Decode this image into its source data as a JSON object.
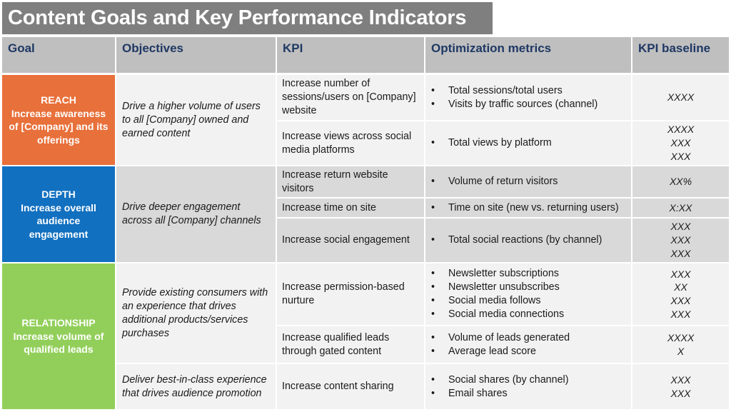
{
  "title": "Content Goals and Key Performance Indicators",
  "headers": {
    "goal": "Goal",
    "objectives": "Objectives",
    "kpi": "KPI",
    "metrics": "Optimization metrics",
    "baseline": "KPI baseline"
  },
  "colors": {
    "title_bg": "#7f7f7f",
    "header_bg": "#bfbfbf",
    "header_text": "#1f3864",
    "reach": "#e8703a",
    "depth": "#1270c0",
    "relationship": "#92cf5a",
    "row_light": "#f2f2f2",
    "row_mid": "#d9d9d9"
  },
  "goals": [
    {
      "name": "REACH",
      "description": "Increase awareness of [Company] and its offerings",
      "objectives": [
        "Drive a higher volume of users to all [Company] owned and earned content"
      ],
      "kpis": [
        {
          "kpi": "Increase number of sessions/users on [Company] website",
          "metrics": [
            "Total sessions/total users",
            "Visits by traffic sources (channel)"
          ],
          "baseline": [
            "XXXX"
          ]
        },
        {
          "kpi": "Increase views across social media platforms",
          "metrics": [
            "Total views by platform"
          ],
          "baseline": [
            "XXXX",
            "XXX",
            "XXX"
          ]
        }
      ]
    },
    {
      "name": "DEPTH",
      "description": "Increase overall audience engagement",
      "objectives": [
        "Drive deeper engagement across all [Company] channels"
      ],
      "kpis": [
        {
          "kpi": "Increase return website visitors",
          "metrics": [
            "Volume of return visitors"
          ],
          "baseline": [
            "XX%"
          ]
        },
        {
          "kpi": "Increase time on site",
          "metrics": [
            "Time on site (new vs. returning users)"
          ],
          "baseline": [
            "X:XX"
          ]
        },
        {
          "kpi": "Increase social engagement",
          "metrics": [
            "Total social reactions (by channel)"
          ],
          "baseline": [
            "XXX",
            "XXX",
            "XXX"
          ]
        }
      ]
    },
    {
      "name": "RELATIONSHIP",
      "description": "Increase volume of qualified leads",
      "objectives": [
        "Provide existing consumers with an experience that drives additional products/services purchases",
        "Deliver best-in-class experience that drives audience promotion"
      ],
      "kpis": [
        {
          "kpi": "Increase permission-based nurture",
          "metrics": [
            "Newsletter subscriptions",
            "Newsletter unsubscribes",
            "Social media follows",
            "Social media connections"
          ],
          "baseline": [
            "XXX",
            "XX",
            "XXX",
            "XXX"
          ]
        },
        {
          "kpi": "Increase qualified leads through gated content",
          "metrics": [
            "Volume of leads generated",
            "Average lead score"
          ],
          "baseline": [
            "XXXX",
            "X"
          ]
        },
        {
          "kpi": "Increase content sharing",
          "metrics": [
            "Social shares (by channel)",
            "Email shares"
          ],
          "baseline": [
            "XXX",
            "XXX"
          ]
        }
      ]
    }
  ]
}
